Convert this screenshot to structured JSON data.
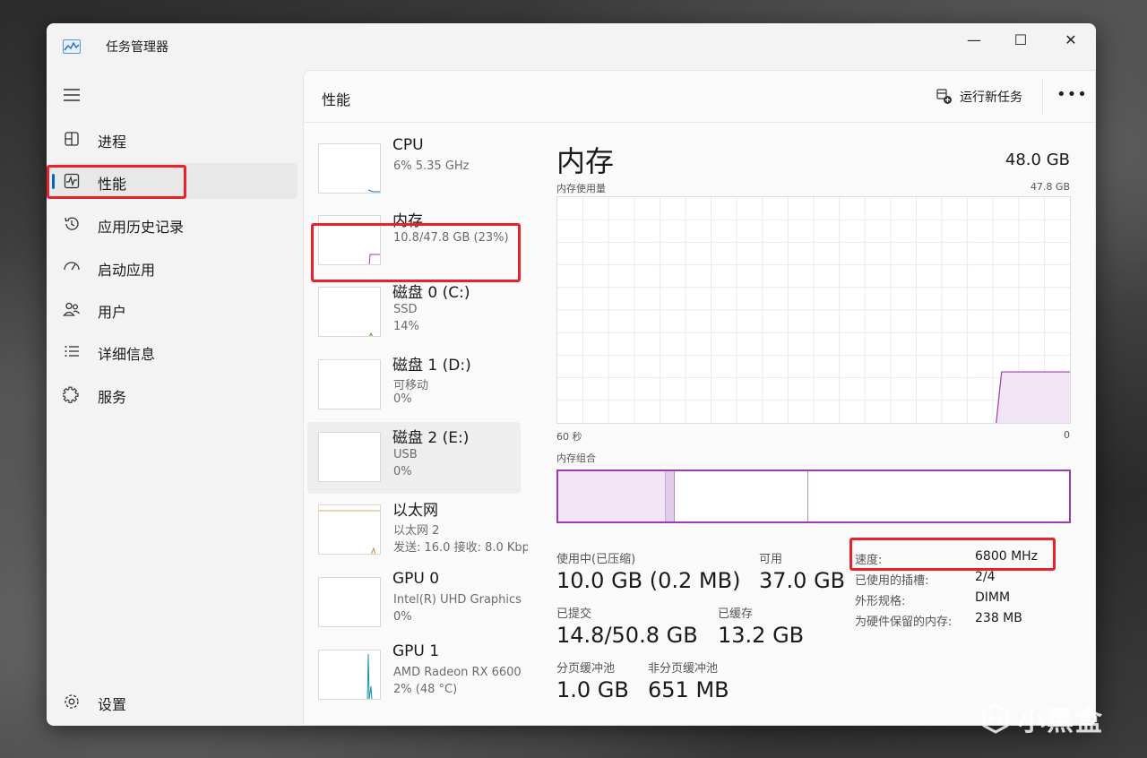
{
  "window": {
    "title": "任务管理器"
  },
  "window_controls": {
    "minimize": "—",
    "maximize": "☐",
    "close": "✕"
  },
  "sidebar": {
    "items": [
      {
        "label": "进程",
        "icon": "processes-icon"
      },
      {
        "label": "性能",
        "icon": "performance-icon",
        "active": true
      },
      {
        "label": "应用历史记录",
        "icon": "history-icon"
      },
      {
        "label": "启动应用",
        "icon": "startup-icon"
      },
      {
        "label": "用户",
        "icon": "users-icon"
      },
      {
        "label": "详细信息",
        "icon": "details-icon"
      },
      {
        "label": "服务",
        "icon": "services-icon"
      }
    ],
    "settings": {
      "label": "设置",
      "icon": "gear-icon"
    }
  },
  "header": {
    "title": "性能",
    "run_task": "运行新任务",
    "more": "•••"
  },
  "resources": [
    {
      "name": "CPU",
      "sub1": "6%  5.35 GHz",
      "sub2": ""
    },
    {
      "name": "内存",
      "sub1": "10.8/47.8 GB (23%)",
      "sub2": ""
    },
    {
      "name": "磁盘 0 (C:)",
      "sub1": "SSD",
      "sub2": "14%"
    },
    {
      "name": "磁盘 1 (D:)",
      "sub1": "可移动",
      "sub2": "0%"
    },
    {
      "name": "磁盘 2 (E:)",
      "sub1": "USB",
      "sub2": "0%"
    },
    {
      "name": "以太网",
      "sub1": "以太网 2",
      "sub2": "发送: 16.0  接收: 8.0 Kbps"
    },
    {
      "name": "GPU 0",
      "sub1": "Intel(R) UHD Graphics",
      "sub2": "0%"
    },
    {
      "name": "GPU 1",
      "sub1": "AMD Radeon RX 6600",
      "sub2": "2% (48 °C)"
    }
  ],
  "detail": {
    "title": "内存",
    "total": "48.0 GB",
    "usage_label": "内存使用量",
    "usage_max": "47.8 GB",
    "axis_left": "60 秒",
    "axis_right": "0",
    "composition_label": "内存组合",
    "stats": {
      "in_use_label": "使用中(已压缩)",
      "in_use_value": "10.0 GB (0.2 MB)",
      "available_label": "可用",
      "available_value": "37.0 GB",
      "committed_label": "已提交",
      "committed_value": "14.8/50.8 GB",
      "cached_label": "已缓存",
      "cached_value": "13.2 GB",
      "paged_label": "分页缓冲池",
      "paged_value": "1.0 GB",
      "nonpaged_label": "非分页缓冲池",
      "nonpaged_value": "651 MB"
    },
    "specs": [
      {
        "label": "速度:",
        "value": "6800 MHz"
      },
      {
        "label": "已使用的插槽:",
        "value": "2/4"
      },
      {
        "label": "外形规格:",
        "value": "DIMM"
      },
      {
        "label": "为硬件保留的内存:",
        "value": "238 MB"
      }
    ]
  },
  "chart_data": {
    "type": "area",
    "title": "内存使用量",
    "xlabel": "",
    "ylabel": "",
    "x_range": [
      60,
      0
    ],
    "ylim": [
      0,
      47.8
    ],
    "series": [
      {
        "values": [
          0,
          0,
          0,
          0,
          0,
          0,
          0,
          0,
          0,
          0,
          0,
          0,
          0,
          0,
          0,
          0,
          0,
          0,
          0,
          0,
          0,
          0,
          0,
          0,
          0,
          0,
          0,
          0,
          0,
          0,
          0,
          0,
          0,
          0,
          0,
          0,
          0,
          0,
          0,
          0,
          0,
          0,
          0,
          0,
          0,
          0,
          0,
          0,
          0,
          0,
          0,
          0,
          10.8,
          10.8,
          10.8,
          10.8,
          10.8,
          10.8,
          10.8,
          10.8,
          10.8
        ]
      }
    ],
    "grid": true,
    "colors": {
      "line": "#9a3db0",
      "fill": "#f1e4f4"
    }
  },
  "composition": {
    "in_use_fraction": 0.209,
    "modified_fraction": 0.018,
    "standby_fraction": 0.26
  },
  "watermark": {
    "text": "小黑盒"
  }
}
